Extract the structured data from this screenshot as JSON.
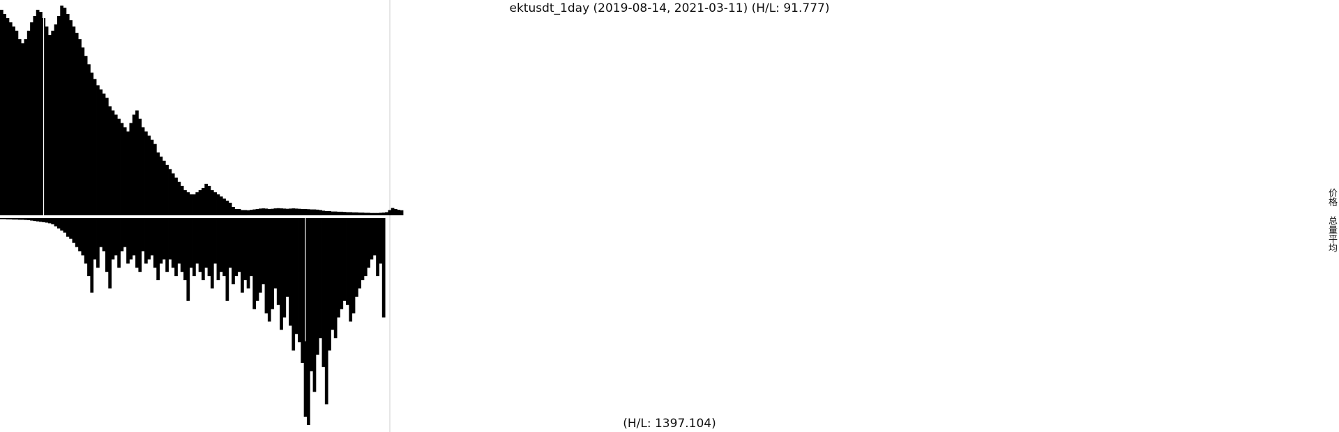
{
  "chart_data": {
    "type": "bar",
    "title": "ektusdt_1day (2019-08-14, 2021-03-11) (H/L: 91.777)",
    "x_range": [
      "2019-08-14",
      "2021-03-11"
    ],
    "price_high_low_ratio": 91.777,
    "volume_high_low_ratio": 1397.104,
    "bottom_label": "(H/L: 1397.104)",
    "legend": [
      "价格",
      "总量平均"
    ],
    "legend_placement": "right",
    "colors": {
      "bars": "#000000",
      "marker_line": "#cccccc",
      "highlight": "#ffffff"
    },
    "series": [
      {
        "name": "价格",
        "values": [
          98,
          96,
          94,
          92,
          90,
          88,
          84,
          82,
          84,
          88,
          92,
          95,
          98,
          97,
          94,
          90,
          86,
          88,
          91,
          95,
          100,
          99,
          96,
          93,
          90,
          87,
          84,
          80,
          76,
          72,
          68,
          65,
          62,
          60,
          58,
          56,
          52,
          50,
          48,
          46,
          44,
          42,
          40,
          44,
          48,
          50,
          46,
          42,
          40,
          38,
          36,
          34,
          30,
          28,
          26,
          24,
          22,
          20,
          18,
          16,
          14,
          12,
          11,
          10,
          10,
          11,
          12,
          13,
          15,
          14,
          12,
          11,
          10,
          9,
          8,
          7,
          6,
          4,
          3,
          3,
          2.5,
          2.5,
          2.4,
          2.6,
          2.8,
          3,
          3.2,
          3.3,
          3.2,
          3,
          3.1,
          3.3,
          3.4,
          3.3,
          3.2,
          3.1,
          3.2,
          3.3,
          3.2,
          3.1,
          3,
          3,
          2.9,
          2.8,
          2.8,
          2.7,
          2.5,
          2.2,
          2,
          2,
          1.8,
          1.8,
          1.7,
          1.7,
          1.6,
          1.5,
          1.5,
          1.4,
          1.4,
          1.3,
          1.3,
          1.2,
          1.2,
          1.1,
          1.1,
          1.1,
          1.2,
          1.3,
          1.5,
          2.5,
          3.5,
          3,
          2.6,
          2.4
        ]
      },
      {
        "name": "总量平均",
        "values": [
          0.5,
          0.5,
          0.6,
          0.6,
          0.7,
          0.7,
          0.8,
          0.8,
          0.9,
          1,
          1.2,
          1.4,
          1.6,
          1.8,
          2,
          2.2,
          2.5,
          3,
          4,
          5,
          6,
          7,
          9,
          10,
          12,
          14,
          16,
          18,
          22,
          28,
          36,
          20,
          24,
          14,
          16,
          26,
          34,
          20,
          18,
          24,
          16,
          14,
          22,
          20,
          18,
          24,
          26,
          16,
          22,
          20,
          18,
          24,
          30,
          22,
          20,
          26,
          20,
          24,
          28,
          22,
          26,
          30,
          40,
          24,
          28,
          22,
          26,
          30,
          24,
          28,
          34,
          22,
          30,
          26,
          28,
          40,
          24,
          32,
          28,
          26,
          36,
          30,
          34,
          28,
          44,
          40,
          36,
          32,
          46,
          50,
          44,
          34,
          42,
          54,
          48,
          38,
          52,
          64,
          56,
          60,
          70,
          96,
          100,
          74,
          84,
          66,
          58,
          72,
          90,
          64,
          54,
          58,
          48,
          44,
          40,
          42,
          50,
          46,
          38,
          34,
          30,
          28,
          24,
          20,
          18,
          28,
          22,
          48
        ]
      }
    ],
    "marker_indices": {
      "price_highlight": 14,
      "volume_highlight": 101
    }
  }
}
